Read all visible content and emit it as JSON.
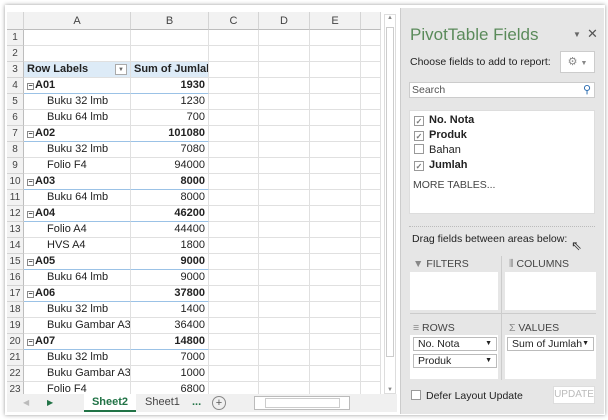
{
  "grid": {
    "columns": [
      "A",
      "B",
      "C",
      "D",
      "E"
    ],
    "rows": [
      {
        "n": "1",
        "a": "",
        "b": "",
        "t": "empty"
      },
      {
        "n": "2",
        "a": "",
        "b": "",
        "t": "empty"
      },
      {
        "n": "3",
        "a": "Row Labels",
        "b": "Sum of Jumlah",
        "t": "header"
      },
      {
        "n": "4",
        "a": "A01",
        "b": "1930",
        "t": "group"
      },
      {
        "n": "5",
        "a": "Buku 32 lmb",
        "b": "1230",
        "t": "item"
      },
      {
        "n": "6",
        "a": "Buku 64 lmb",
        "b": "700",
        "t": "item"
      },
      {
        "n": "7",
        "a": "A02",
        "b": "101080",
        "t": "group"
      },
      {
        "n": "8",
        "a": "Buku 32 lmb",
        "b": "7080",
        "t": "item"
      },
      {
        "n": "9",
        "a": "Folio F4",
        "b": "94000",
        "t": "item"
      },
      {
        "n": "10",
        "a": "A03",
        "b": "8000",
        "t": "group"
      },
      {
        "n": "11",
        "a": "Buku 64 lmb",
        "b": "8000",
        "t": "item"
      },
      {
        "n": "12",
        "a": "A04",
        "b": "46200",
        "t": "group"
      },
      {
        "n": "13",
        "a": "Folio A4",
        "b": "44400",
        "t": "item"
      },
      {
        "n": "14",
        "a": "HVS A4",
        "b": "1800",
        "t": "item"
      },
      {
        "n": "15",
        "a": "A05",
        "b": "9000",
        "t": "group"
      },
      {
        "n": "16",
        "a": "Buku 64 lmb",
        "b": "9000",
        "t": "item"
      },
      {
        "n": "17",
        "a": "A06",
        "b": "37800",
        "t": "group"
      },
      {
        "n": "18",
        "a": "Buku 32 lmb",
        "b": "1400",
        "t": "item"
      },
      {
        "n": "19",
        "a": "Buku Gambar A3",
        "b": "36400",
        "t": "item"
      },
      {
        "n": "20",
        "a": "A07",
        "b": "14800",
        "t": "group"
      },
      {
        "n": "21",
        "a": "Buku 32 lmb",
        "b": "7000",
        "t": "item"
      },
      {
        "n": "22",
        "a": "Buku Gambar A3",
        "b": "1000",
        "t": "item"
      },
      {
        "n": "23",
        "a": "Folio F4",
        "b": "6800",
        "t": "item"
      }
    ]
  },
  "tabs": {
    "active": "Sheet2",
    "other": "Sheet1",
    "more": "...",
    "add": "+"
  },
  "panel": {
    "title": "PivotTable Fields",
    "choose": "Choose fields to add to report:",
    "search_placeholder": "Search",
    "fields": [
      {
        "label": "No. Nota",
        "checked": true
      },
      {
        "label": "Produk",
        "checked": true
      },
      {
        "label": "Bahan",
        "checked": false
      },
      {
        "label": "Jumlah",
        "checked": true
      }
    ],
    "more_tables": "MORE TABLES...",
    "drag": "Drag fields between areas below:",
    "filters": "FILTERS",
    "columns": "COLUMNS",
    "rows": "ROWS",
    "values": "VALUES",
    "rows_items": [
      "No. Nota",
      "Produk"
    ],
    "values_items": [
      "Sum of Jumlah"
    ],
    "defer": "Defer Layout Update",
    "update": "UPDATE"
  },
  "colors": {
    "accent": "#217346",
    "header_fill": "#ddebf7",
    "title": "#5a8a5a"
  }
}
